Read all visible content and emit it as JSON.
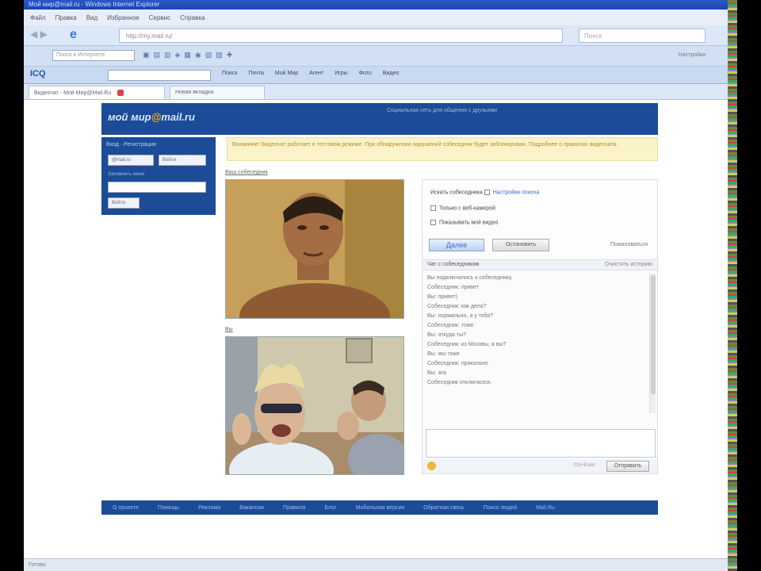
{
  "browser": {
    "title": "Мой мир@mail.ru - Windows Internet Explorer",
    "menu": [
      "Файл",
      "Правка",
      "Вид",
      "Избранное",
      "Сервис",
      "Справка"
    ],
    "address": "http://my.mail.ru/",
    "search_placeholder": "Поиск",
    "toolbar_input_placeholder": "Поиск в Интернете",
    "toolbar_right": "Настройки",
    "toolbar2_logo": "ICQ",
    "toolbar2_items": [
      "Поиск",
      "Почта",
      "Мой Мир",
      "Агент",
      "Игры",
      "Фото",
      "Видео"
    ],
    "tabs": [
      {
        "label": "Видеочат - Мой Мир@Mail.Ru",
        "active": true
      },
      {
        "label": "Новая вкладка",
        "active": false
      }
    ],
    "status": "Готово"
  },
  "site": {
    "logo_prefix": "мой мир",
    "logo_at": "@",
    "logo_suffix": "mail.ru",
    "slogan": "Социальная сеть для общения с друзьями",
    "login": {
      "title": "Вход  ·  Регистрация",
      "email_btn": "@mail.ru",
      "login_btn": "Войти",
      "link": "Запомнить меня",
      "submit": "Войти"
    },
    "notice": "Внимание! Видеочат работает в тестовом режиме. При обнаружении нарушений собеседник будет заблокирован. Подробнее о правилах видеочата.",
    "cam1_label": "Ваш собеседник",
    "cam2_label": "Вы",
    "chat": {
      "option1_prefix": "Искать собеседника",
      "option1_link": "Настройки поиска",
      "option2": "Только с веб-камерой",
      "option3": "Показывать моё видео",
      "next_btn": "Далее",
      "stop_btn": "Остановить",
      "report": "Пожаловаться",
      "tab_left": "Чат с собеседником",
      "tab_right": "Очистить историю",
      "log": [
        "Вы подключились к собеседнику.",
        "Собеседник: привет",
        "Вы: привет)",
        "Собеседник: как дела?",
        "Вы: нормально, а у тебя?",
        "Собеседник: тоже",
        "Вы: откуда ты?",
        "Собеседник: из Москвы, а вы?",
        "Вы: мы тоже",
        "Собеседник: прикольно",
        "Вы: ага",
        "Собеседник отключился."
      ],
      "send_hint": "Ctrl+Enter",
      "send_btn": "Отправить"
    },
    "footer": [
      "О проекте",
      "Помощь",
      "Реклама",
      "Вакансии",
      "Правила",
      "Блог",
      "Мобильная версия",
      "Обратная связь",
      "Поиск людей",
      "Mail.Ru"
    ]
  },
  "colors": {
    "site_blue": "#1c4c97",
    "notice_bg": "#fbf3c8",
    "logo_accent": "#ffb400"
  }
}
